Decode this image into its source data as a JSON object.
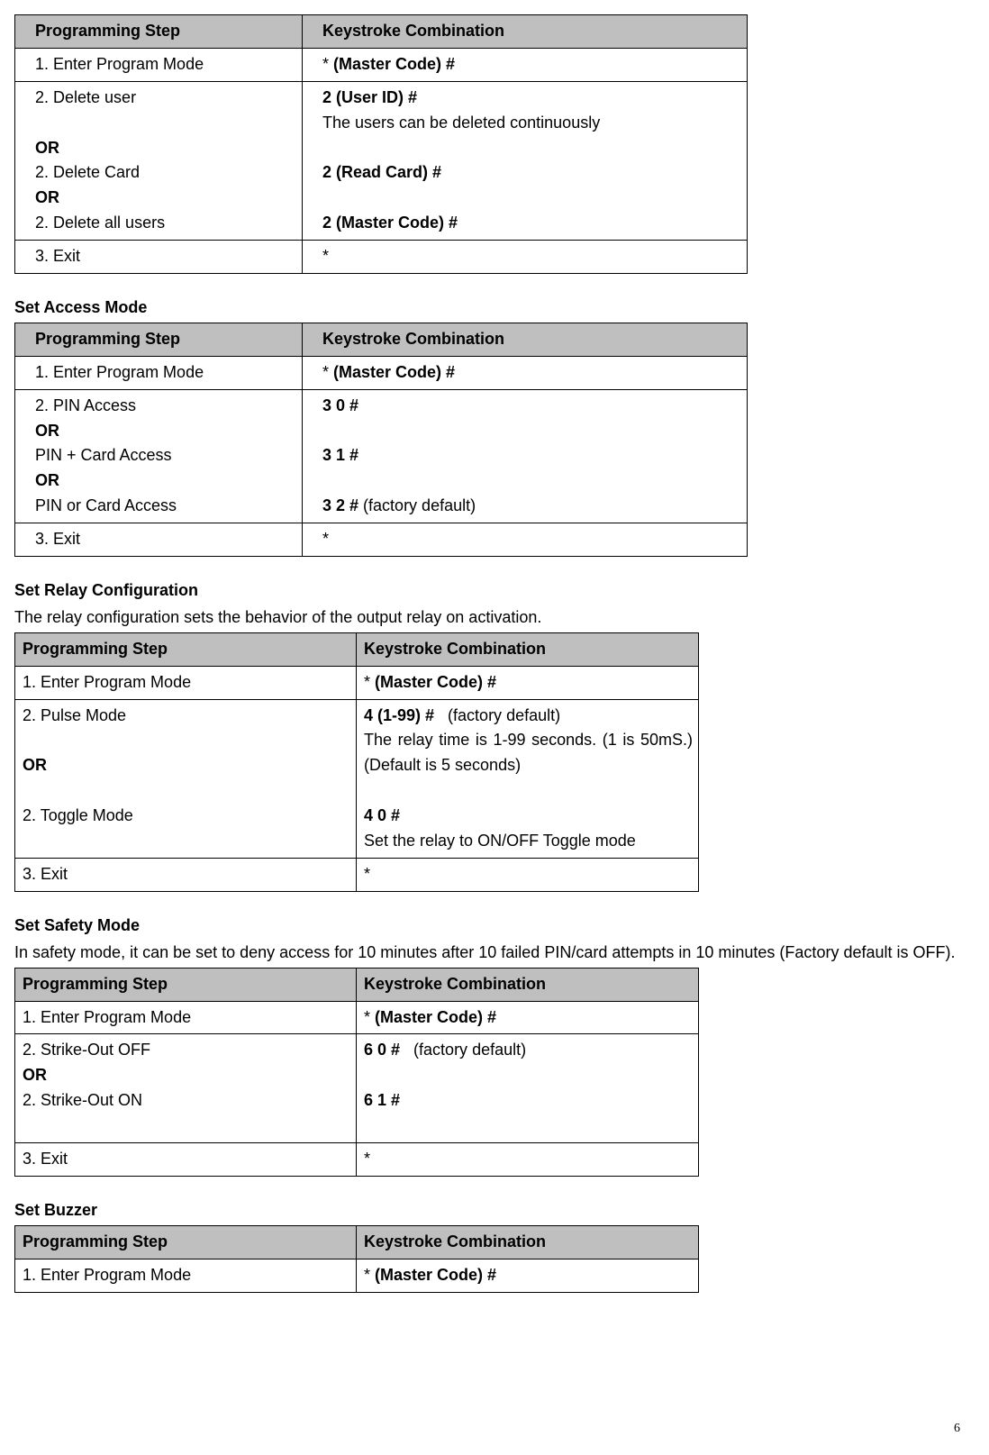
{
  "page_number": "6",
  "tables": [
    {
      "class": "t1",
      "col_class": "col1a",
      "headers": [
        "Programming Step",
        "Keystroke Combination"
      ],
      "rows": [
        {
          "c1": [
            {
              "text": "1. Enter Program Mode"
            }
          ],
          "c2": [
            {
              "text": "* "
            },
            {
              "text": "(Master Code) #",
              "bold": true
            }
          ]
        },
        {
          "c1": [
            {
              "text": "2. Delete user"
            },
            {
              "text": " "
            },
            {
              "text": "OR",
              "bold": true
            },
            {
              "text": "2. Delete Card"
            },
            {
              "text": "OR",
              "bold": true
            },
            {
              "text": "2. Delete all users"
            }
          ],
          "c2": [
            {
              "text": "2 (User ID) #",
              "bold": true
            },
            {
              "text": "The users can be deleted continuously"
            },
            {
              "text": " "
            },
            {
              "text": "2 (Read Card) #",
              "bold": true
            },
            {
              "text": " "
            },
            {
              "text": "2 (Master Code) #",
              "bold": true
            }
          ]
        },
        {
          "c1": [
            {
              "text": "3. Exit"
            }
          ],
          "c2": [
            {
              "text": "*"
            }
          ]
        }
      ]
    },
    {
      "title": "Set Access Mode",
      "class": "t1",
      "col_class": "col1a",
      "headers": [
        "Programming Step",
        "Keystroke Combination"
      ],
      "rows": [
        {
          "c1": [
            {
              "text": "1. Enter Program Mode"
            }
          ],
          "c2": [
            {
              "text": "* "
            },
            {
              "text": "(Master Code) #",
              "bold": true
            }
          ]
        },
        {
          "c1": [
            {
              "text": "2. PIN Access"
            },
            {
              "text": "OR",
              "bold": true
            },
            {
              "text": "PIN + Card Access"
            },
            {
              "text": "OR",
              "bold": true
            },
            {
              "text": "PIN or Card Access"
            }
          ],
          "c2": [
            {
              "text": "3 0 #",
              "bold": true
            },
            {
              "text": " "
            },
            {
              "text": "3 1 #",
              "bold": true
            },
            {
              "text": " "
            },
            {
              "parts": [
                {
                  "text": "3 2 # ",
                  "bold": true
                },
                {
                  "text": "(factory default)"
                }
              ]
            }
          ]
        },
        {
          "c1": [
            {
              "text": "3. Exit"
            }
          ],
          "c2": [
            {
              "text": "*"
            }
          ]
        }
      ]
    },
    {
      "title": "Set Relay Configuration",
      "desc": "The relay configuration sets the behavior of the output relay on activation.",
      "class": "t2",
      "col_class": "col1b",
      "headers": [
        "Programming Step",
        "Keystroke Combination"
      ],
      "rows": [
        {
          "c1": [
            {
              "text": "1. Enter Program Mode"
            }
          ],
          "c2": [
            {
              "text": "* "
            },
            {
              "text": "(Master Code) #",
              "bold": true
            }
          ]
        },
        {
          "c1": [
            {
              "text": "2. Pulse Mode"
            },
            {
              "text": " "
            },
            {
              "text": "OR",
              "bold": true
            },
            {
              "text": " "
            },
            {
              "text": "2. Toggle Mode"
            }
          ],
          "c2": [
            {
              "parts": [
                {
                  "text": "4 (1-99) #",
                  "bold": true
                },
                {
                  "text": "   (factory default)"
                }
              ]
            },
            {
              "text": "The relay time is 1-99 seconds. (1 is 50mS.) (Default is 5 seconds)",
              "just": true
            },
            {
              "text": " "
            },
            {
              "text": "4 0 #",
              "bold": true
            },
            {
              "text": "Set the relay to ON/OFF Toggle mode"
            }
          ]
        },
        {
          "c1": [
            {
              "text": "3. Exit"
            }
          ],
          "c2": [
            {
              "text": "*"
            }
          ]
        }
      ]
    },
    {
      "title": "Set Safety Mode",
      "desc": "In safety mode, it can be set to deny access for 10 minutes after 10 failed PIN/card attempts in 10 minutes (Factory default is OFF).",
      "class": "t2",
      "col_class": "col1b",
      "headers": [
        "Programming Step",
        "Keystroke Combination"
      ],
      "rows": [
        {
          "c1": [
            {
              "text": "1. Enter Program Mode"
            }
          ],
          "c2": [
            {
              "text": "* "
            },
            {
              "text": "(Master Code) #",
              "bold": true
            }
          ]
        },
        {
          "c1": [
            {
              "text": "2. Strike-Out OFF"
            },
            {
              "text": "OR",
              "bold": true
            },
            {
              "text": "2. Strike-Out ON"
            },
            {
              "text": " "
            }
          ],
          "c2": [
            {
              "parts": [
                {
                  "text": "6 0 #",
                  "bold": true
                },
                {
                  "text": "   (factory default)"
                }
              ]
            },
            {
              "text": " "
            },
            {
              "text": "6 1 #",
              "bold": true
            },
            {
              "text": " "
            }
          ]
        },
        {
          "c1": [
            {
              "text": "3. Exit"
            }
          ],
          "c2": [
            {
              "text": "*"
            }
          ]
        }
      ]
    },
    {
      "title": "Set Buzzer",
      "class": "t2",
      "col_class": "col1b",
      "headers": [
        "Programming Step",
        "Keystroke Combination"
      ],
      "rows": [
        {
          "c1": [
            {
              "text": "1. Enter Program Mode"
            }
          ],
          "c2": [
            {
              "text": "* "
            },
            {
              "text": "(Master Code) #",
              "bold": true
            }
          ]
        }
      ]
    }
  ]
}
